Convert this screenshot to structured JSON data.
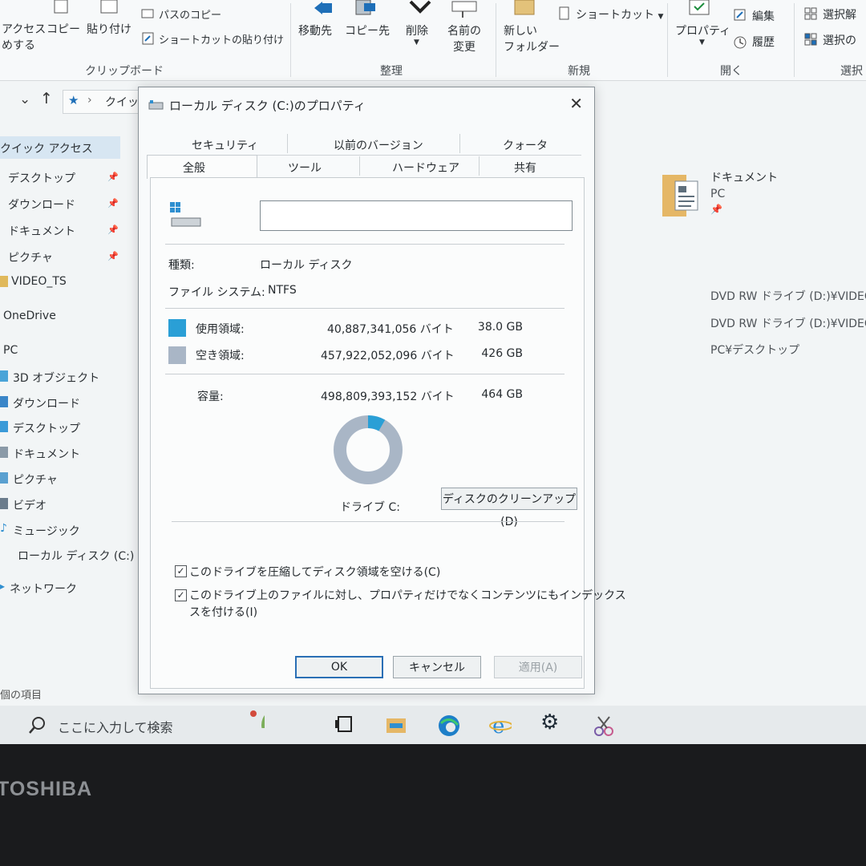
{
  "ribbon": {
    "quick_access_line1": "アクセス",
    "quick_access_line2": "めする",
    "copy": "コピー",
    "paste": "貼り付け",
    "copy_path": "パスのコピー",
    "paste_shortcut": "ショートカットの貼り付け",
    "move_to": "移動先",
    "copy_to": "コピー先",
    "delete": "削除",
    "rename_line1": "名前の",
    "rename_line2": "変更",
    "new_folder_line1": "新しい",
    "new_folder_line2": "フォルダー",
    "shortcut": "ショートカット",
    "properties": "プロパティ",
    "edit": "編集",
    "history": "履歴",
    "select_none": "選択解",
    "select_invert": "選択の",
    "groups": {
      "clipboard": "クリップボード",
      "organize": "整理",
      "new": "新規",
      "open": "開く",
      "select": "選択"
    }
  },
  "address": {
    "crumb": "クイッ"
  },
  "nav": {
    "quick_access": "クイック アクセス",
    "items": [
      "デスクトップ",
      "ダウンロード",
      "ドキュメント",
      "ピクチャ",
      "VIDEO_TS",
      "OneDrive",
      "PC",
      "3D オブジェクト",
      "ダウンロード",
      "デスクトップ",
      "ドキュメント",
      "ピクチャ",
      "ビデオ",
      "ミュージック",
      "ローカル ディスク (C:)",
      "ネットワーク"
    ],
    "status": "個の項目"
  },
  "content": {
    "doc_title": "ドキュメント",
    "doc_sub": "PC",
    "recent": [
      "DVD RW ドライブ (D:)¥VIDEO_",
      "DVD RW ドライブ (D:)¥VIDEO_",
      "PC¥デスクトップ"
    ]
  },
  "taskbar": {
    "search_placeholder": "ここに入力して検索"
  },
  "dialog": {
    "title": "ローカル ディスク (C:)のプロパティ",
    "tabs_row1": [
      "セキュリティ",
      "以前のバージョン",
      "クォータ"
    ],
    "tabs_row2": [
      "全般",
      "ツール",
      "ハードウェア",
      "共有"
    ],
    "name_value": "",
    "type_label": "種類:",
    "type_value": "ローカル ディスク",
    "fs_label": "ファイル システム:",
    "fs_value": "NTFS",
    "used_label": "使用領域:",
    "used_bytes": "40,887,341,056 バイト",
    "used_gb": "38.0 GB",
    "free_label": "空き領域:",
    "free_bytes": "457,922,052,096 バイト",
    "free_gb": "426 GB",
    "cap_label": "容量:",
    "cap_bytes": "498,809,393,152 バイト",
    "cap_gb": "464 GB",
    "used_fraction": 0.082,
    "used_color": "#2a9fd6",
    "free_color": "#a9b6c6",
    "drive_label": "ドライブ C:",
    "cleanup_button": "ディスクのクリーンアップ(D)",
    "compress_label": "このドライブを圧縮してディスク領域を空ける(C)",
    "index_label_line1": "このドライブ上のファイルに対し、プロパティだけでなくコンテンツにもインデックス",
    "index_label_line2": "スを付ける(I)",
    "compress_checked": true,
    "index_checked": true,
    "ok": "OK",
    "cancel": "キャンセル",
    "apply": "適用(A)"
  },
  "bezel": {
    "brand": "TOSHIBA"
  }
}
